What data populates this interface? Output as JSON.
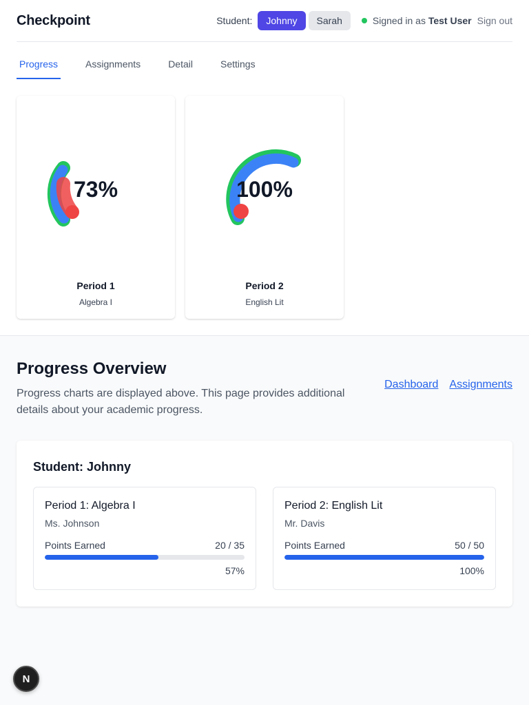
{
  "header": {
    "brand": "Checkpoint",
    "student_label": "Student:",
    "students": [
      "Johnny",
      "Sarah"
    ],
    "active_student": "Johnny",
    "signed_in_prefix": "Signed in as",
    "user_name": "Test User",
    "sign_out": "Sign out"
  },
  "tabs": [
    {
      "label": "Progress",
      "active": true
    },
    {
      "label": "Assignments",
      "active": false
    },
    {
      "label": "Detail",
      "active": false
    },
    {
      "label": "Settings",
      "active": false
    }
  ],
  "gauges": [
    {
      "percent_label": "73%",
      "percent": 73,
      "title": "Period 1",
      "subtitle": "Algebra I",
      "dot_color": "#ef4444"
    },
    {
      "percent_label": "100%",
      "percent": 100,
      "title": "Period 2",
      "subtitle": "English Lit",
      "dot_color": "#ef4444"
    }
  ],
  "overview": {
    "title": "Progress Overview",
    "description": "Progress charts are displayed above. This page provides additional details about your academic progress.",
    "links": [
      "Dashboard",
      "Assignments"
    ]
  },
  "student_card": {
    "title": "Student: Johnny",
    "periods": [
      {
        "name": "Period 1: Algebra I",
        "teacher": "Ms. Johnson",
        "points_label": "Points Earned",
        "points": "20 / 35",
        "percent_label": "57%",
        "fill": 0.57
      },
      {
        "name": "Period 2: English Lit",
        "teacher": "Mr. Davis",
        "points_label": "Points Earned",
        "points": "50 / 50",
        "percent_label": "100%",
        "fill": 1.0
      }
    ]
  },
  "badge": {
    "letter": "N"
  },
  "colors": {
    "accent": "#4f46e5",
    "link": "#2563eb",
    "status": "#22c55e",
    "gauge_blue": "#3b82f6",
    "gauge_green": "#22c55e",
    "gauge_red": "#ef4444"
  }
}
